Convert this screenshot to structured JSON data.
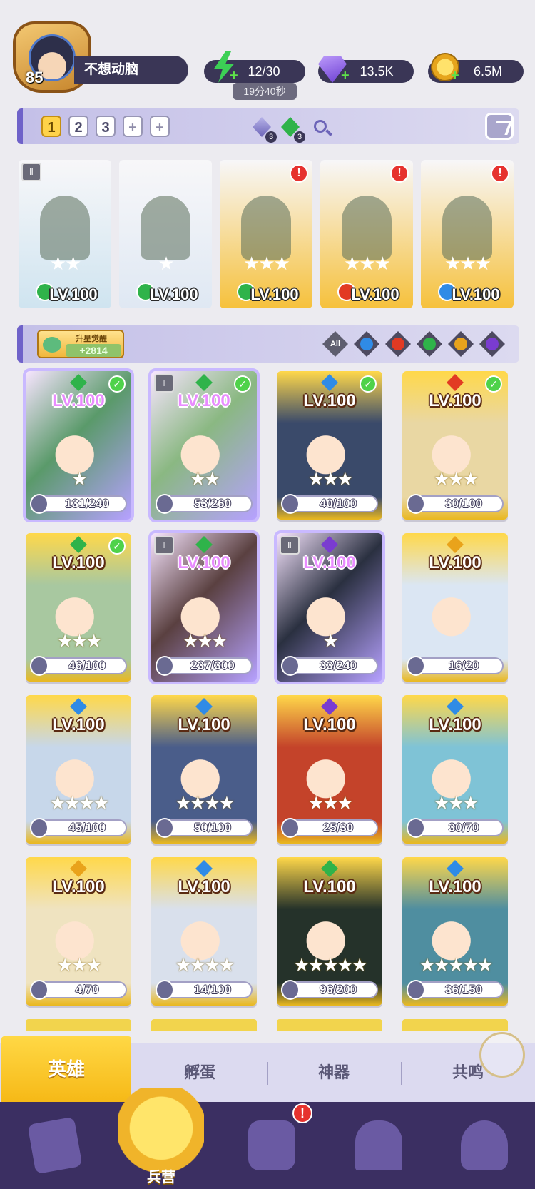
{
  "player": {
    "level": "85",
    "name": "不想动脑"
  },
  "resources": {
    "energy": "12/30",
    "energy_timer": "19分40秒",
    "gems": "13.5K",
    "gold": "6.5M"
  },
  "team_bar": {
    "tabs": [
      "1",
      "2",
      "3",
      "+",
      "+"
    ],
    "active_tab": "1",
    "badges": [
      "3",
      "3"
    ]
  },
  "selected_team": [
    {
      "level": "LV.100",
      "stars": "★★",
      "element": "nature",
      "alert": "",
      "rune": "Ⅱ",
      "color": "#cfe4f0"
    },
    {
      "level": "LV.100",
      "stars": "★",
      "element": "nature",
      "alert": "",
      "rune": "",
      "color": "#dfe8f3"
    },
    {
      "level": "LV.100",
      "stars": "★★★",
      "element": "nature",
      "alert": "!",
      "rune": "",
      "color": "#f6c13c"
    },
    {
      "level": "LV.100",
      "stars": "★★★",
      "element": "fire",
      "alert": "!",
      "rune": "",
      "color": "#f6c13c"
    },
    {
      "level": "LV.100",
      "stars": "★★★",
      "element": "water",
      "alert": "!",
      "rune": "",
      "color": "#f6c13c"
    }
  ],
  "filter": {
    "awaken_label": "升星觉醒",
    "awaken_count": "+2814",
    "all_label": "All",
    "elements": [
      "water",
      "fire",
      "nature",
      "light",
      "dark"
    ]
  },
  "element_colors": {
    "water": "#2f8be6",
    "fire": "#e23a23",
    "nature": "#2fb34a",
    "light": "#e9a31b",
    "dark": "#7a3cd0"
  },
  "heroes": [
    {
      "level": "LV.100",
      "stars": "★",
      "shards": "131/240",
      "element": "nature",
      "check": true,
      "rune": "",
      "rarity": "purple",
      "bg": "#5a9a6a"
    },
    {
      "level": "LV.100",
      "stars": "★★",
      "shards": "53/260",
      "element": "nature",
      "check": true,
      "rune": "Ⅱ",
      "rarity": "purple",
      "bg": "#8ab882"
    },
    {
      "level": "LV.100",
      "stars": "★★★",
      "shards": "40/100",
      "element": "water",
      "check": true,
      "rune": "",
      "rarity": "gold",
      "bg": "#3a4a6a"
    },
    {
      "level": "LV.100",
      "stars": "★★★",
      "shards": "30/100",
      "element": "fire",
      "check": true,
      "rune": "",
      "rarity": "gold",
      "bg": "#e9d7a3"
    },
    {
      "level": "LV.100",
      "stars": "★★★",
      "shards": "46/100",
      "element": "nature",
      "check": true,
      "rune": "",
      "rarity": "gold",
      "bg": "#a8c8a0"
    },
    {
      "level": "LV.100",
      "stars": "★★★",
      "shards": "237/300",
      "element": "nature",
      "check": false,
      "rune": "Ⅱ",
      "rarity": "purple",
      "bg": "#5a4040"
    },
    {
      "level": "LV.100",
      "stars": "★",
      "shards": "33/240",
      "element": "dark",
      "check": false,
      "rune": "Ⅱ",
      "rarity": "purple",
      "bg": "#2a3040"
    },
    {
      "level": "LV.100",
      "stars": "",
      "shards": "16/20",
      "element": "light",
      "check": false,
      "rune": "",
      "rarity": "gold",
      "bg": "#dbe6f3"
    },
    {
      "level": "LV.100",
      "stars": "★★★★",
      "shards": "45/100",
      "element": "water",
      "check": false,
      "rune": "",
      "rarity": "gold",
      "bg": "#c7d7ea"
    },
    {
      "level": "LV.100",
      "stars": "★★★★",
      "shards": "50/100",
      "element": "water",
      "check": false,
      "rune": "",
      "rarity": "gold",
      "bg": "#4a5d8a"
    },
    {
      "level": "LV.100",
      "stars": "★★★",
      "shards": "25/30",
      "element": "dark",
      "check": false,
      "rune": "",
      "rarity": "gold",
      "bg": "#c4432a"
    },
    {
      "level": "LV.100",
      "stars": "★★★",
      "shards": "30/70",
      "element": "water",
      "check": false,
      "rune": "",
      "rarity": "gold",
      "bg": "#7fc3d6"
    },
    {
      "level": "LV.100",
      "stars": "★★★",
      "shards": "4/70",
      "element": "light",
      "check": false,
      "rune": "",
      "rarity": "gold",
      "bg": "#efe3c0"
    },
    {
      "level": "LV.100",
      "stars": "★★★★",
      "shards": "14/100",
      "element": "water",
      "check": false,
      "rune": "",
      "rarity": "gold",
      "bg": "#d9e0ec"
    },
    {
      "level": "LV.100",
      "stars": "★★★★★",
      "shards": "96/200",
      "element": "nature",
      "check": false,
      "rune": "",
      "rarity": "gold",
      "bg": "#25322a"
    },
    {
      "level": "LV.100",
      "stars": "★★★★★",
      "shards": "36/150",
      "element": "water",
      "check": false,
      "rune": "",
      "rarity": "gold",
      "bg": "#4f8ea0"
    }
  ],
  "subtabs": [
    "英雄",
    "孵蛋",
    "神器",
    "共鸣"
  ],
  "nav": {
    "active_label": "兵营",
    "alert": "!"
  }
}
